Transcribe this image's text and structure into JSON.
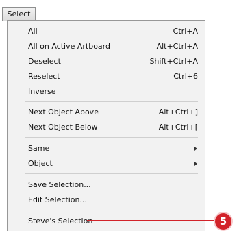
{
  "menubar": {
    "label": "Select"
  },
  "menu": {
    "items": [
      {
        "label": "All",
        "shortcut": "Ctrl+A"
      },
      {
        "label": "All on Active Artboard",
        "shortcut": "Alt+Ctrl+A"
      },
      {
        "label": "Deselect",
        "shortcut": "Shift+Ctrl+A"
      },
      {
        "label": "Reselect",
        "shortcut": "Ctrl+6"
      },
      {
        "label": "Inverse",
        "shortcut": ""
      },
      {
        "label": "Next Object Above",
        "shortcut": "Alt+Ctrl+]"
      },
      {
        "label": "Next Object Below",
        "shortcut": "Alt+Ctrl+["
      },
      {
        "label": "Same",
        "submenu": "true"
      },
      {
        "label": "Object",
        "submenu": "true"
      },
      {
        "label": "Save Selection..."
      },
      {
        "label": "Edit Selection..."
      },
      {
        "label": "Steve's Selection"
      }
    ]
  },
  "callout": {
    "number": "5",
    "color": "#d2232a"
  }
}
